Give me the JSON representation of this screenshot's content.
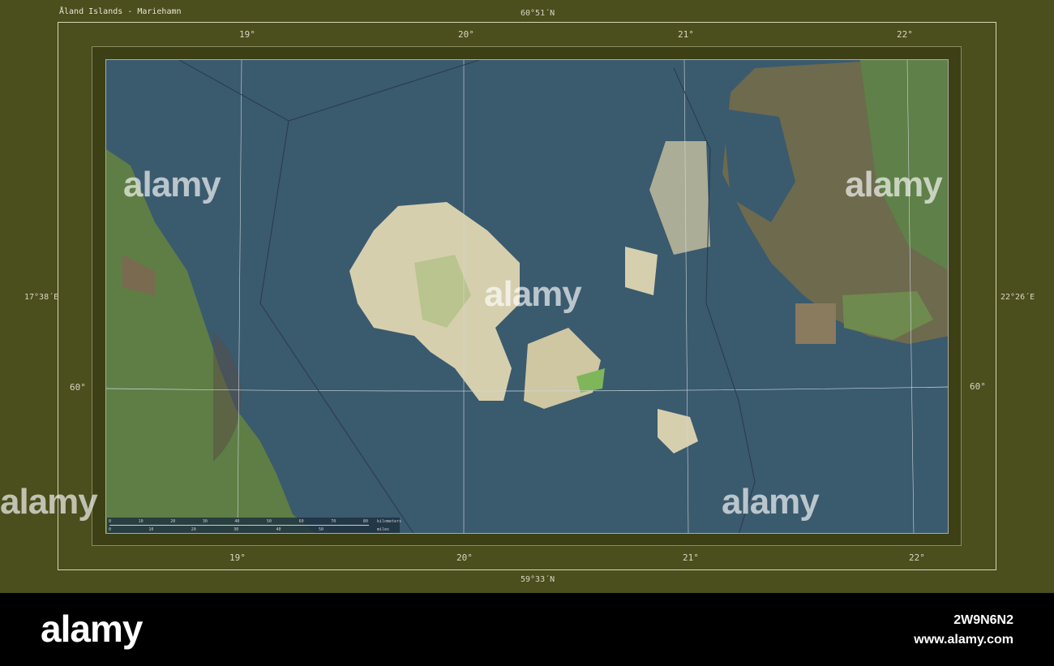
{
  "title": "Åland Islands - Mariehamn",
  "bounds": {
    "north": "60°51´N",
    "south": "59°33´N",
    "west": "17°38´E",
    "east": "22°26´E"
  },
  "longitudes": [
    "19°",
    "20°",
    "21°",
    "22°"
  ],
  "latitudes": [
    "60°"
  ],
  "scale_bar": {
    "km_ticks": [
      "0",
      "10",
      "20",
      "30",
      "40",
      "50",
      "60",
      "70",
      "80"
    ],
    "km_unit": "kilometers",
    "mi_ticks": [
      "0",
      "10",
      "20",
      "30",
      "40",
      "50"
    ],
    "mi_unit": "miles"
  },
  "colors": {
    "water": "#3a5a6e",
    "land_green": "#5e7e45",
    "land_brown": "#7a6a50",
    "islands": "#d6cfae",
    "frame": "#4b4e1d"
  },
  "watermark": {
    "logo": "alamy",
    "site": "www.alamy.com",
    "image_id": "2W9N6N2"
  }
}
